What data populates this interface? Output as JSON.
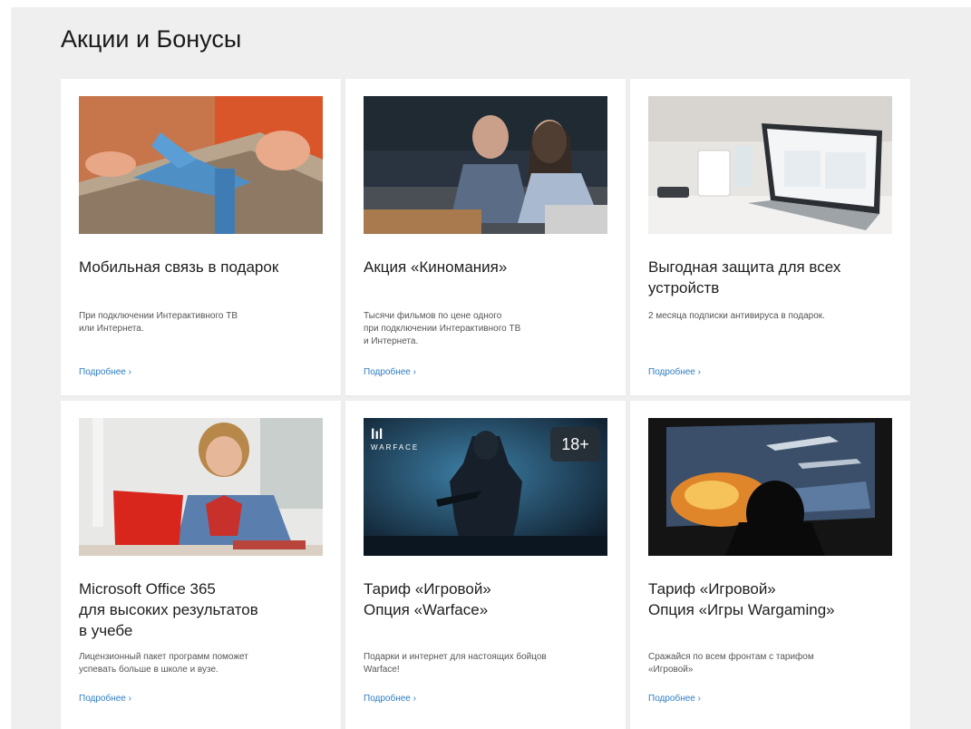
{
  "page_title": "Акции и Бонусы",
  "cards": [
    {
      "title": "Мобильная связь в подарок",
      "description": "При подключении Интерактивного ТВ\nили Интернета.",
      "link": "Подробнее ›",
      "image": "gift-photo"
    },
    {
      "title": "Акция «Киномания»",
      "description": "Тысячи фильмов по цене одного\nпри подключении Интерактивного ТВ\nи Интернета.",
      "link": "Подробнее ›",
      "image": "couple-watching-tv-photo"
    },
    {
      "title": "Выгодная защита для всех\nустройств",
      "description": "2 месяца подписки антивируса в подарок.",
      "link": "Подробнее ›",
      "image": "laptop-photo"
    },
    {
      "title": "Microsoft Office 365\nдля высоких результатов\nв учебе",
      "description": "Лицензионный пакет программ поможет\nуспевать больше в школе и вузе.",
      "link": "Подробнее ›",
      "image": "student-laptop-photo"
    },
    {
      "title": "Тариф «Игровой»\nОпция «Warface»",
      "description": "Подарки и интернет для настоящих бойцов\nWarface!",
      "link": "Подробнее ›",
      "image": "warface-soldier-art",
      "badge": "18+",
      "brand": "WARFACE"
    },
    {
      "title": "Тариф «Игровой»\nОпция «Игры Wargaming»",
      "description": "Сражайся по всем фронтам с тарифом\n«Игровой»",
      "link": "Подробнее ›",
      "image": "gamer-tanks-art"
    }
  ]
}
